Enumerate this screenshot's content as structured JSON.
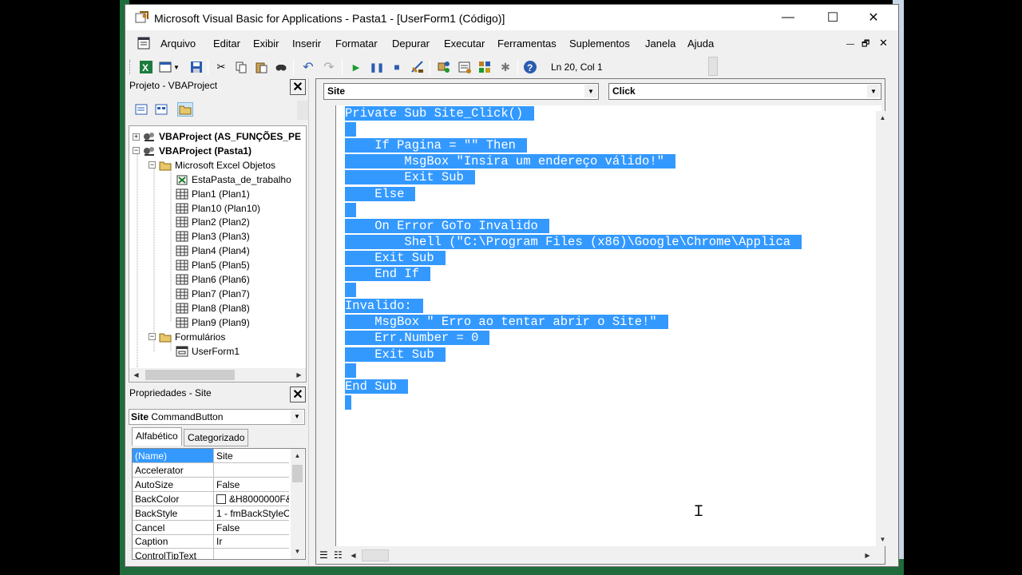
{
  "window": {
    "title": "Microsoft Visual Basic for Applications - Pasta1 - [UserForm1 (Código)]",
    "minimize_glyph": "—",
    "maximize_glyph": "☐",
    "close_glyph": "✕"
  },
  "menu": {
    "items": [
      "Arquivo",
      "Editar",
      "Exibir",
      "Inserir",
      "Formatar",
      "Depurar",
      "Executar",
      "Ferramentas",
      "Suplementos",
      "Janela",
      "Ajuda"
    ],
    "restore_glyph": "🗗",
    "close_glyph": "✕"
  },
  "toolbar": {
    "position_text": "Ln 20, Col 1",
    "icons": [
      "excel-view-icon",
      "insert-userform-icon",
      "save-icon",
      "cut-icon",
      "copy-icon",
      "paste-icon",
      "find-icon",
      "undo-icon",
      "redo-icon",
      "run-icon",
      "break-icon",
      "reset-icon",
      "design-mode-icon",
      "project-explorer-icon",
      "properties-icon",
      "object-browser-icon",
      "toolbox-icon",
      "help-icon"
    ]
  },
  "project": {
    "title": "Projeto - VBAProject",
    "close_glyph": "✕",
    "tree": [
      {
        "label": "VBAProject (AS_FUNÇÕES_PE",
        "bold": true,
        "expander": "+",
        "level": 0,
        "icon": "vba-project-icon"
      },
      {
        "label": "VBAProject (Pasta1)",
        "bold": true,
        "expander": "−",
        "level": 0,
        "icon": "vba-project-icon"
      },
      {
        "label": "Microsoft Excel Objetos",
        "expander": "−",
        "level": 1,
        "icon": "folder-icon"
      },
      {
        "label": "EstaPasta_de_trabalho",
        "level": 2,
        "icon": "workbook-icon"
      },
      {
        "label": "Plan1 (Plan1)",
        "level": 2,
        "icon": "worksheet-icon"
      },
      {
        "label": "Plan10 (Plan10)",
        "level": 2,
        "icon": "worksheet-icon"
      },
      {
        "label": "Plan2 (Plan2)",
        "level": 2,
        "icon": "worksheet-icon"
      },
      {
        "label": "Plan3 (Plan3)",
        "level": 2,
        "icon": "worksheet-icon"
      },
      {
        "label": "Plan4 (Plan4)",
        "level": 2,
        "icon": "worksheet-icon"
      },
      {
        "label": "Plan5 (Plan5)",
        "level": 2,
        "icon": "worksheet-icon"
      },
      {
        "label": "Plan6 (Plan6)",
        "level": 2,
        "icon": "worksheet-icon"
      },
      {
        "label": "Plan7 (Plan7)",
        "level": 2,
        "icon": "worksheet-icon"
      },
      {
        "label": "Plan8 (Plan8)",
        "level": 2,
        "icon": "worksheet-icon"
      },
      {
        "label": "Plan9 (Plan9)",
        "level": 2,
        "icon": "worksheet-icon"
      },
      {
        "label": "Formulários",
        "expander": "−",
        "level": 1,
        "icon": "folder-icon"
      },
      {
        "label": "UserForm1",
        "level": 2,
        "icon": "userform-icon"
      }
    ]
  },
  "properties": {
    "title": "Propriedades - Site",
    "close_glyph": "✕",
    "object_name": "Site",
    "object_type": "CommandButton",
    "tabs": [
      "Alfabético",
      "Categorizado"
    ],
    "active_tab": "Alfabético",
    "rows": [
      {
        "name": "(Name)",
        "value": "Site",
        "selected": true
      },
      {
        "name": "Accelerator",
        "value": ""
      },
      {
        "name": "AutoSize",
        "value": "False"
      },
      {
        "name": "BackColor",
        "value": "&H8000000F&",
        "swatch": true
      },
      {
        "name": "BackStyle",
        "value": "1 - fmBackStyleO"
      },
      {
        "name": "Cancel",
        "value": "False"
      },
      {
        "name": "Caption",
        "value": "Ir"
      },
      {
        "name": "ControlTipText",
        "value": ""
      }
    ]
  },
  "code": {
    "object_combo": "Site",
    "procedure_combo": "Click",
    "selection_color": "#3399ff",
    "lines": [
      "Private Sub Site_Click()",
      "",
      "    If Pagina = \"\" Then",
      "        MsgBox \"Insira um endereço válido!\"",
      "        Exit Sub",
      "    Else",
      "",
      "    On Error GoTo Invalido",
      "        Shell (\"C:\\Program Files (x86)\\Google\\Chrome\\Applica",
      "    Exit Sub",
      "    End If",
      "",
      "Invalido:",
      "    MsgBox \" Erro ao tentar abrir o Site!\"",
      "    Err.Number = 0",
      "    Exit Sub",
      "",
      "End Sub",
      ""
    ]
  }
}
